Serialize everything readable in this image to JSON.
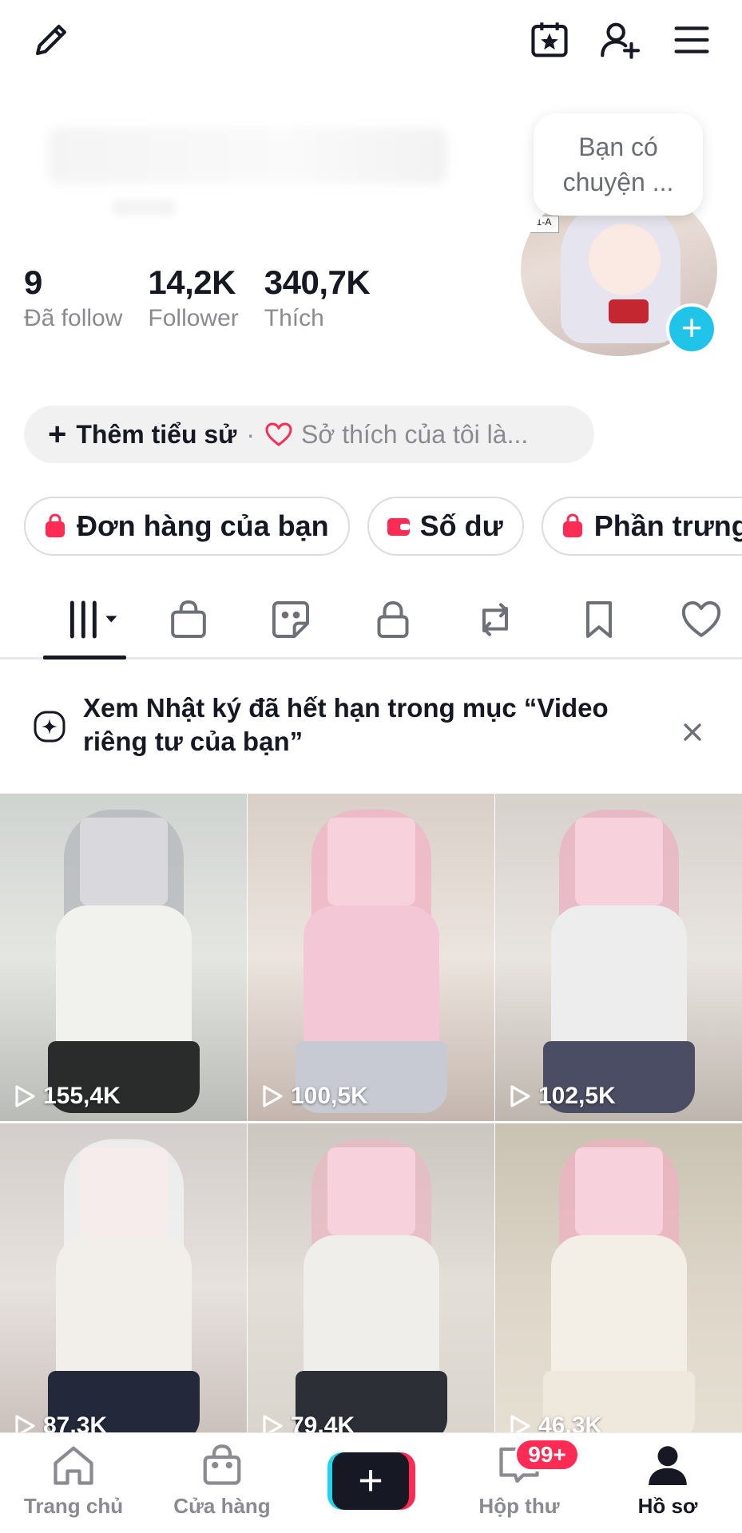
{
  "top_bar": {
    "icons": [
      "edit-pencil-icon",
      "calendar-star-icon",
      "add-friend-icon",
      "menu-icon"
    ]
  },
  "profile": {
    "stats": [
      {
        "value": "9",
        "label": "Đã follow"
      },
      {
        "value": "14,2K",
        "label": "Follower"
      },
      {
        "value": "340,7K",
        "label": "Thích"
      }
    ],
    "bubble_text": "Bạn có chuyện ...",
    "avatar_sign": "1-A",
    "add_button": "+"
  },
  "bio": {
    "add_label": "Thêm tiểu sử",
    "separator": "·",
    "hobby_placeholder": "Sở thích của tôi là..."
  },
  "shortcuts": [
    {
      "label": "Đơn hàng của bạn",
      "icon": "bag-icon"
    },
    {
      "label": "Số dư",
      "icon": "wallet-icon"
    },
    {
      "label": "Phần trưng",
      "icon": "bag-icon"
    }
  ],
  "tabs": [
    "videos-grid-icon",
    "shop-bag-icon",
    "sticker-icon",
    "lock-icon",
    "repost-icon",
    "bookmark-icon",
    "heart-icon"
  ],
  "notice": {
    "message": "Xem Nhật ký đã hết hạn trong mục “Video riêng tư của bạn”"
  },
  "videos": [
    {
      "views": "155,4K"
    },
    {
      "views": "100,5K"
    },
    {
      "views": "102,5K"
    },
    {
      "views": "87,3K"
    },
    {
      "views": "79,4K"
    },
    {
      "views": "46,3K"
    }
  ],
  "bottom_nav": {
    "items": [
      {
        "label": "Trang chủ"
      },
      {
        "label": "Cửa hàng"
      },
      {
        "label": "Hộp thư"
      },
      {
        "label": "Hồ sơ"
      }
    ],
    "create_label": "+",
    "inbox_badge": "99+"
  },
  "colors": {
    "accent_pink": "#fe2c55",
    "accent_cyan": "#20d5ec",
    "text_primary": "#161823",
    "text_secondary": "#8a8b91"
  }
}
